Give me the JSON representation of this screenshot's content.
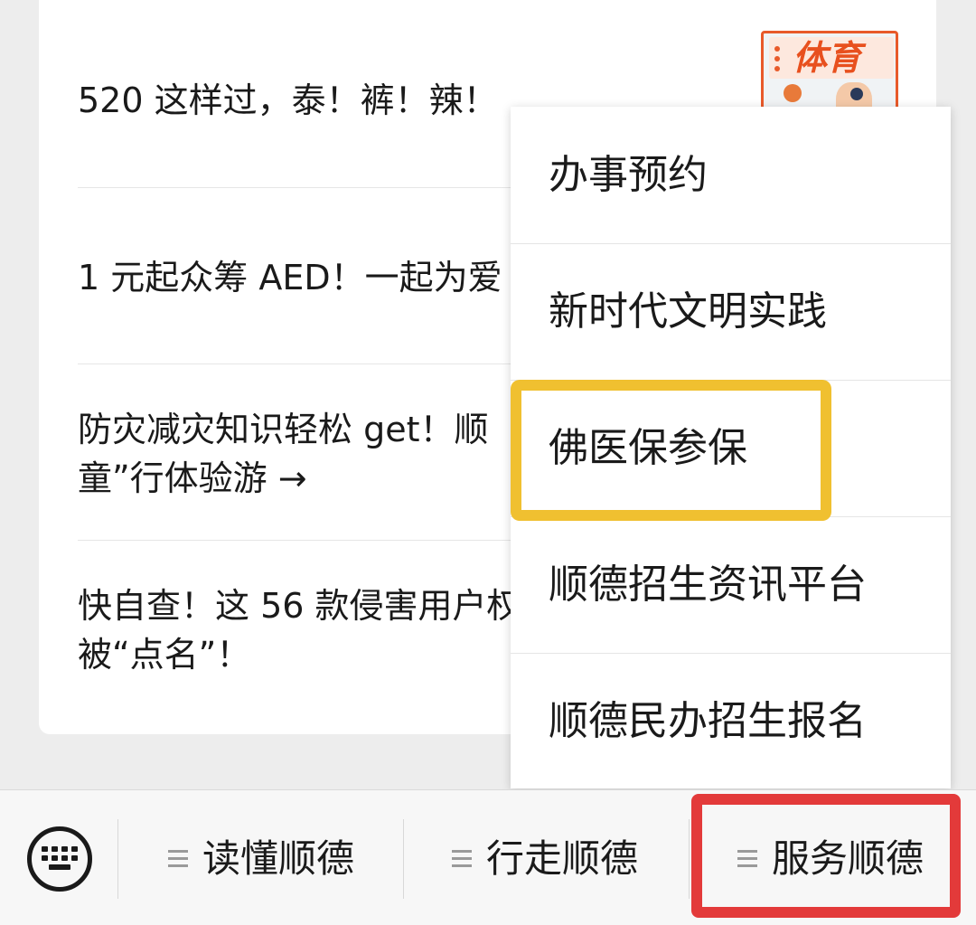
{
  "articles": [
    {
      "text": "520 这样过，泰！裤！辣！"
    },
    {
      "text": "1 元起众筹 AED！一起为爱"
    },
    {
      "text": "防灾减灾知识轻松 get！顺\n童”行体验游 →"
    },
    {
      "text": "快自查！这 56 款侵害用户权\n被“点名”！"
    }
  ],
  "thumbnail": {
    "label": "体育",
    "accent": "#e85a2a",
    "icon": "sports-thumbnail"
  },
  "menu": {
    "items": [
      {
        "label": "办事预约"
      },
      {
        "label": "新时代文明实践"
      },
      {
        "label": "佛医保参保"
      },
      {
        "label": "顺德招生资讯平台"
      },
      {
        "label": "顺德民办招生报名"
      }
    ],
    "highlight_color": "#f0c030"
  },
  "bottom_bar": {
    "keyboard_icon": "keyboard-icon",
    "tabs": [
      {
        "label": "读懂顺德"
      },
      {
        "label": "行走顺德"
      },
      {
        "label": "服务顺德"
      }
    ],
    "highlight_color": "#e33a3a"
  }
}
